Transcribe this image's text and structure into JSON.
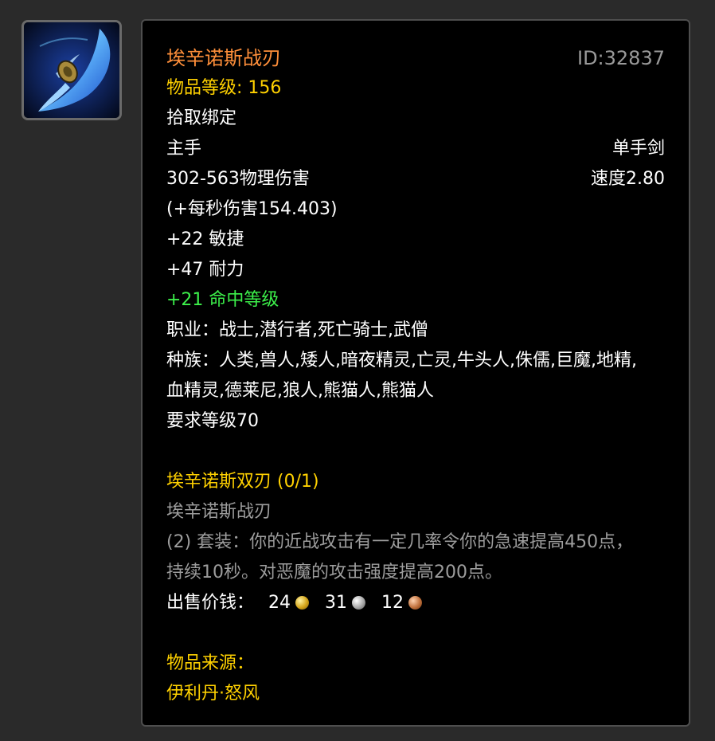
{
  "item": {
    "name": "埃辛诺斯战刃",
    "id_text": "ID:32837",
    "item_level": "物品等级: 156",
    "binding": "拾取绑定",
    "slot": "主手",
    "weapon_type": "单手剑",
    "damage": "302-563物理伤害",
    "speed": "速度2.80",
    "dps": "(+每秒伤害154.403)",
    "stats": [
      "+22 敏捷",
      "+47 耐力"
    ],
    "green_stat": "+21 命中等级",
    "classes": "职业：战士,潜行者,死亡骑士,武僧",
    "races": "种族：人类,兽人,矮人,暗夜精灵,亡灵,牛头人,侏儒,巨魔,地精,血精灵,德莱尼,狼人,熊猫人,熊猫人",
    "required_level": "要求等级70"
  },
  "set": {
    "name": "埃辛诺斯双刃 (0/1)",
    "piece": "埃辛诺斯战刃",
    "bonus": "(2) 套装：你的近战攻击有一定几率令你的急速提高450点，持续10秒。对恶魔的攻击强度提高200点。"
  },
  "price": {
    "label": "出售价钱：",
    "gold": "24",
    "silver": "31",
    "copper": "12"
  },
  "source": {
    "label": "物品来源：",
    "value": "伊利丹·怒风"
  },
  "icon": {
    "name": "glaive-icon"
  },
  "colors": {
    "title": "#ff8f3a",
    "yellow": "#ffd100",
    "green": "#3cf04a",
    "gray": "#9d9d9d"
  }
}
